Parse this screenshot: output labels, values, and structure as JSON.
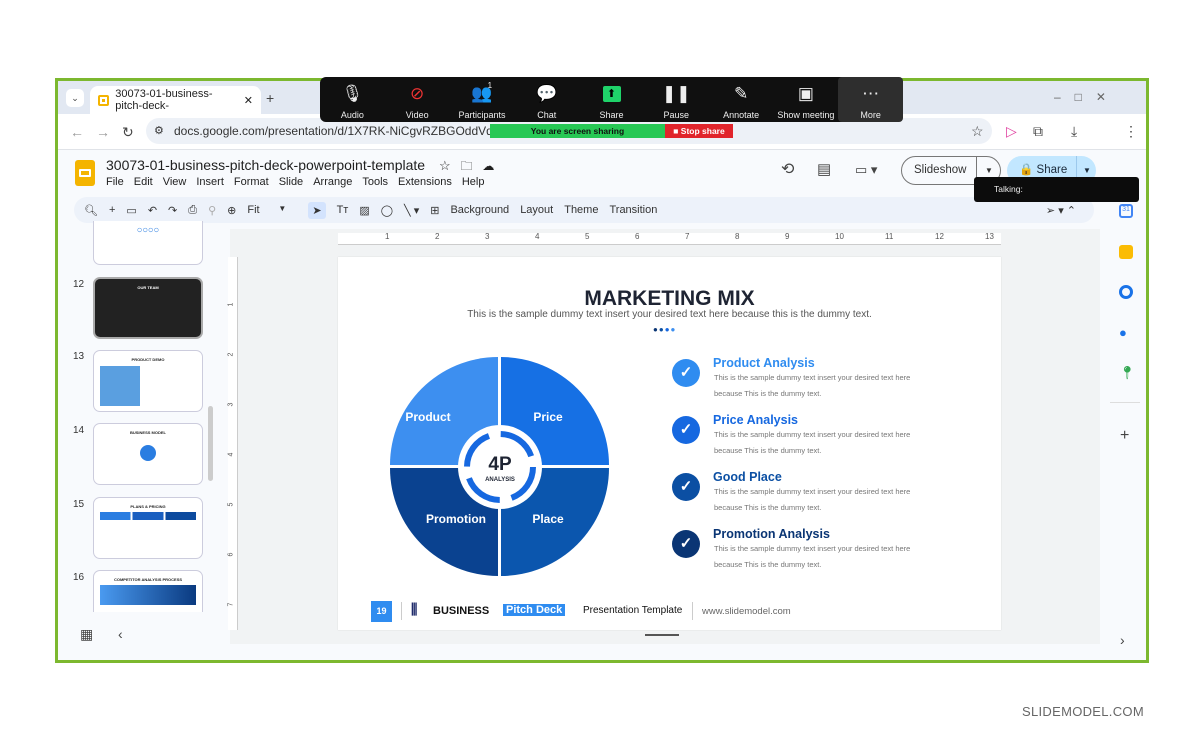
{
  "browser": {
    "tab_title": "30073-01-business-pitch-deck-",
    "url": "docs.google.com/presentation/d/1X7RK-NiCgvRZBGOddVdK6COxgiH_c"
  },
  "zoom": {
    "items": [
      {
        "label": "Audio",
        "icon": "microphone-icon",
        "glyph": "🎙"
      },
      {
        "label": "Video",
        "icon": "video-off-icon",
        "glyph": "⊘"
      },
      {
        "label": "Participants",
        "icon": "participants-icon",
        "glyph": "👥",
        "badge": "1"
      },
      {
        "label": "Chat",
        "icon": "chat-icon",
        "glyph": "💬"
      },
      {
        "label": "Share",
        "icon": "share-screen-icon",
        "glyph": "⬆"
      },
      {
        "label": "Pause",
        "icon": "pause-icon",
        "glyph": "❚❚"
      },
      {
        "label": "Annotate",
        "icon": "pencil-icon",
        "glyph": "✎"
      },
      {
        "label": "Show meeting",
        "icon": "window-icon",
        "glyph": "▣"
      },
      {
        "label": "More",
        "icon": "more-icon",
        "glyph": "⋯"
      }
    ],
    "sharing_label": "You are screen sharing",
    "stop_label": "Stop share",
    "talking": "Talking:"
  },
  "doc": {
    "title": "30073-01-business-pitch-deck-powerpoint-template",
    "menu": [
      "File",
      "Edit",
      "View",
      "Insert",
      "Format",
      "Slide",
      "Arrange",
      "Tools",
      "Extensions",
      "Help"
    ],
    "slideshow": "Slideshow",
    "share": "Share"
  },
  "toolbar": {
    "zoom": "Fit",
    "buttons": [
      "Background",
      "Layout",
      "Theme",
      "Transition"
    ]
  },
  "ruler": {
    "h": [
      "1",
      "2",
      "3",
      "4",
      "5",
      "6",
      "7",
      "8",
      "9",
      "10",
      "11",
      "12",
      "13"
    ],
    "v": [
      "1",
      "2",
      "3",
      "4",
      "5",
      "6",
      "7"
    ]
  },
  "filmstrip": [
    {
      "num": "12",
      "title": "OUR TEAM"
    },
    {
      "num": "13",
      "title": "PRODUCT DEMO"
    },
    {
      "num": "14",
      "title": "BUSINESS MODEL"
    },
    {
      "num": "15",
      "title": "PLANS & PRICING"
    },
    {
      "num": "16",
      "title": "COMPETITOR ANALYSIS PROCESS"
    }
  ],
  "slide": {
    "title": "MARKETING MIX",
    "subtitle": "This is the sample dummy text insert your desired text here because this is the dummy text.",
    "center_big": "4P",
    "center_small": "ANALYSIS",
    "quadrants": [
      {
        "label": "Product",
        "color": "#3d8ff0"
      },
      {
        "label": "Price",
        "color": "#1670e4"
      },
      {
        "label": "Place",
        "color": "#0b56ae"
      },
      {
        "label": "Promotion",
        "color": "#0a4290"
      }
    ],
    "items": [
      {
        "title": "Product Analysis",
        "color": "#2f8cf0",
        "line1": "This is the sample dummy text insert your desired text here",
        "line2": "because This is the dummy text."
      },
      {
        "title": "Price Analysis",
        "color": "#1668e0",
        "line1": "This is the sample dummy text insert your desired text here",
        "line2": "because This is the dummy text."
      },
      {
        "title": "Good Place",
        "color": "#0b4fa3",
        "line1": "This is the sample dummy text insert your desired text here",
        "line2": "because This is the dummy text."
      },
      {
        "title": "Promotion Analysis",
        "color": "#0a3574",
        "line1": "This is the sample dummy text insert your desired text here",
        "line2": "because This is the dummy text."
      }
    ],
    "footer": {
      "page": "19",
      "business": "BUSINESS",
      "pitch": "Pitch Deck",
      "template": "Presentation Template",
      "site": "www.slidemodel.com"
    }
  },
  "watermark": "SLIDEMODEL.COM"
}
